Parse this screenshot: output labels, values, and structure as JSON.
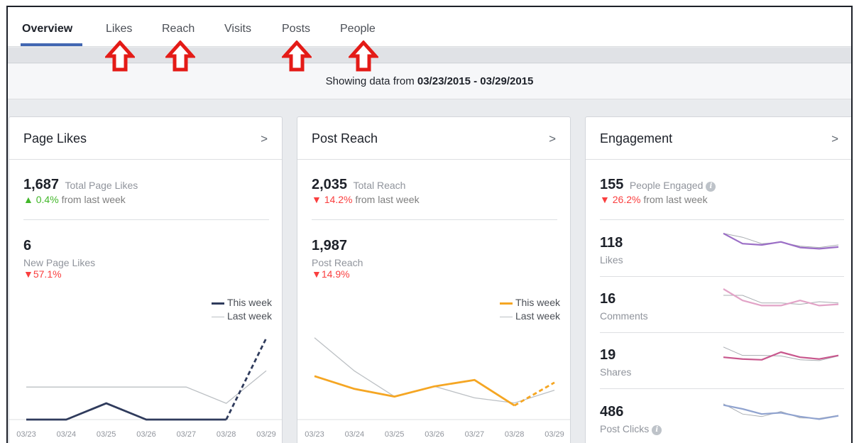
{
  "tabs": [
    {
      "label": "Overview",
      "active": true
    },
    {
      "label": "Likes"
    },
    {
      "label": "Reach"
    },
    {
      "label": "Visits"
    },
    {
      "label": "Posts"
    },
    {
      "label": "People"
    }
  ],
  "date_range": {
    "prefix": "Showing data from",
    "value": "03/23/2015 - 03/29/2015"
  },
  "annotation_arrow_color": "#e41b17",
  "colors": {
    "this_week_likes": "#2f3b5c",
    "this_week_reach": "#f5a623",
    "last_week": "#bcc0c4",
    "accent": "#4267b2",
    "down": "#fa3e3e",
    "up": "#42b72a"
  },
  "page_likes": {
    "title": "Page Likes",
    "chevron": ">",
    "total": "1,687",
    "total_label": "Total Page Likes",
    "total_delta_arrow": "▲",
    "total_delta": "0.4%",
    "total_delta_suffix": "from last week",
    "new_value": "6",
    "new_label": "New Page Likes",
    "new_delta_arrow": "▼",
    "new_delta": "57.1%",
    "legend_this": "This week",
    "legend_last": "Last week"
  },
  "post_reach": {
    "title": "Post Reach",
    "chevron": ">",
    "total": "2,035",
    "total_label": "Total Reach",
    "total_delta_arrow": "▼",
    "total_delta": "14.2%",
    "total_delta_suffix": "from last week",
    "reach_value": "1,987",
    "reach_label": "Post Reach",
    "reach_delta_arrow": "▼",
    "reach_delta": "14.9%",
    "legend_this": "This week",
    "legend_last": "Last week"
  },
  "engagement": {
    "title": "Engagement",
    "chevron": ">",
    "total": "155",
    "total_label": "People Engaged",
    "total_delta_arrow": "▼",
    "total_delta": "26.2%",
    "total_delta_suffix": "from last week",
    "rows": [
      {
        "value": "118",
        "label": "Likes",
        "color": "#9b6ec6",
        "this": [
          0.95,
          0.55,
          0.5,
          0.62,
          0.4,
          0.35,
          0.42
        ],
        "last": [
          0.95,
          0.8,
          0.55,
          0.6,
          0.45,
          0.4,
          0.5
        ]
      },
      {
        "value": "16",
        "label": "Comments",
        "color": "#e2a3c7",
        "this": [
          1.0,
          0.55,
          0.35,
          0.35,
          0.55,
          0.35,
          0.4
        ],
        "last": [
          0.75,
          0.75,
          0.45,
          0.45,
          0.4,
          0.5,
          0.45
        ]
      },
      {
        "value": "19",
        "label": "Shares",
        "color": "#c8578d",
        "this": [
          0.55,
          0.48,
          0.45,
          0.75,
          0.55,
          0.48,
          0.62
        ],
        "last": [
          0.95,
          0.62,
          0.62,
          0.6,
          0.45,
          0.42,
          0.6
        ]
      },
      {
        "value": "486",
        "label": "Post Clicks",
        "color": "#90a3cf",
        "this": [
          0.9,
          0.75,
          0.55,
          0.6,
          0.45,
          0.35,
          0.48
        ],
        "last": [
          0.95,
          0.55,
          0.45,
          0.65,
          0.4,
          0.38,
          0.5
        ]
      }
    ]
  },
  "x_labels": [
    "03/23",
    "03/24",
    "03/25",
    "03/26",
    "03/27",
    "03/28",
    "03/29"
  ],
  "chart_data": [
    {
      "type": "line",
      "x": [
        "03/23",
        "03/24",
        "03/25",
        "03/26",
        "03/27",
        "03/28",
        "03/29"
      ],
      "series": [
        {
          "name": "This week",
          "values": [
            0,
            0,
            2,
            0,
            0,
            0,
            10
          ],
          "dashed_last": true
        },
        {
          "name": "Last week",
          "values": [
            4,
            4,
            4,
            4,
            4,
            2,
            6
          ]
        }
      ],
      "ylim": [
        0,
        11
      ]
    },
    {
      "type": "line",
      "x": [
        "03/23",
        "03/24",
        "03/25",
        "03/26",
        "03/27",
        "03/28",
        "03/29"
      ],
      "series": [
        {
          "name": "This week",
          "values": [
            340,
            240,
            180,
            260,
            310,
            110,
            290
          ],
          "dashed_last": true
        },
        {
          "name": "Last week",
          "values": [
            640,
            380,
            180,
            260,
            170,
            130,
            230
          ]
        }
      ],
      "ylim": [
        0,
        700
      ]
    }
  ]
}
